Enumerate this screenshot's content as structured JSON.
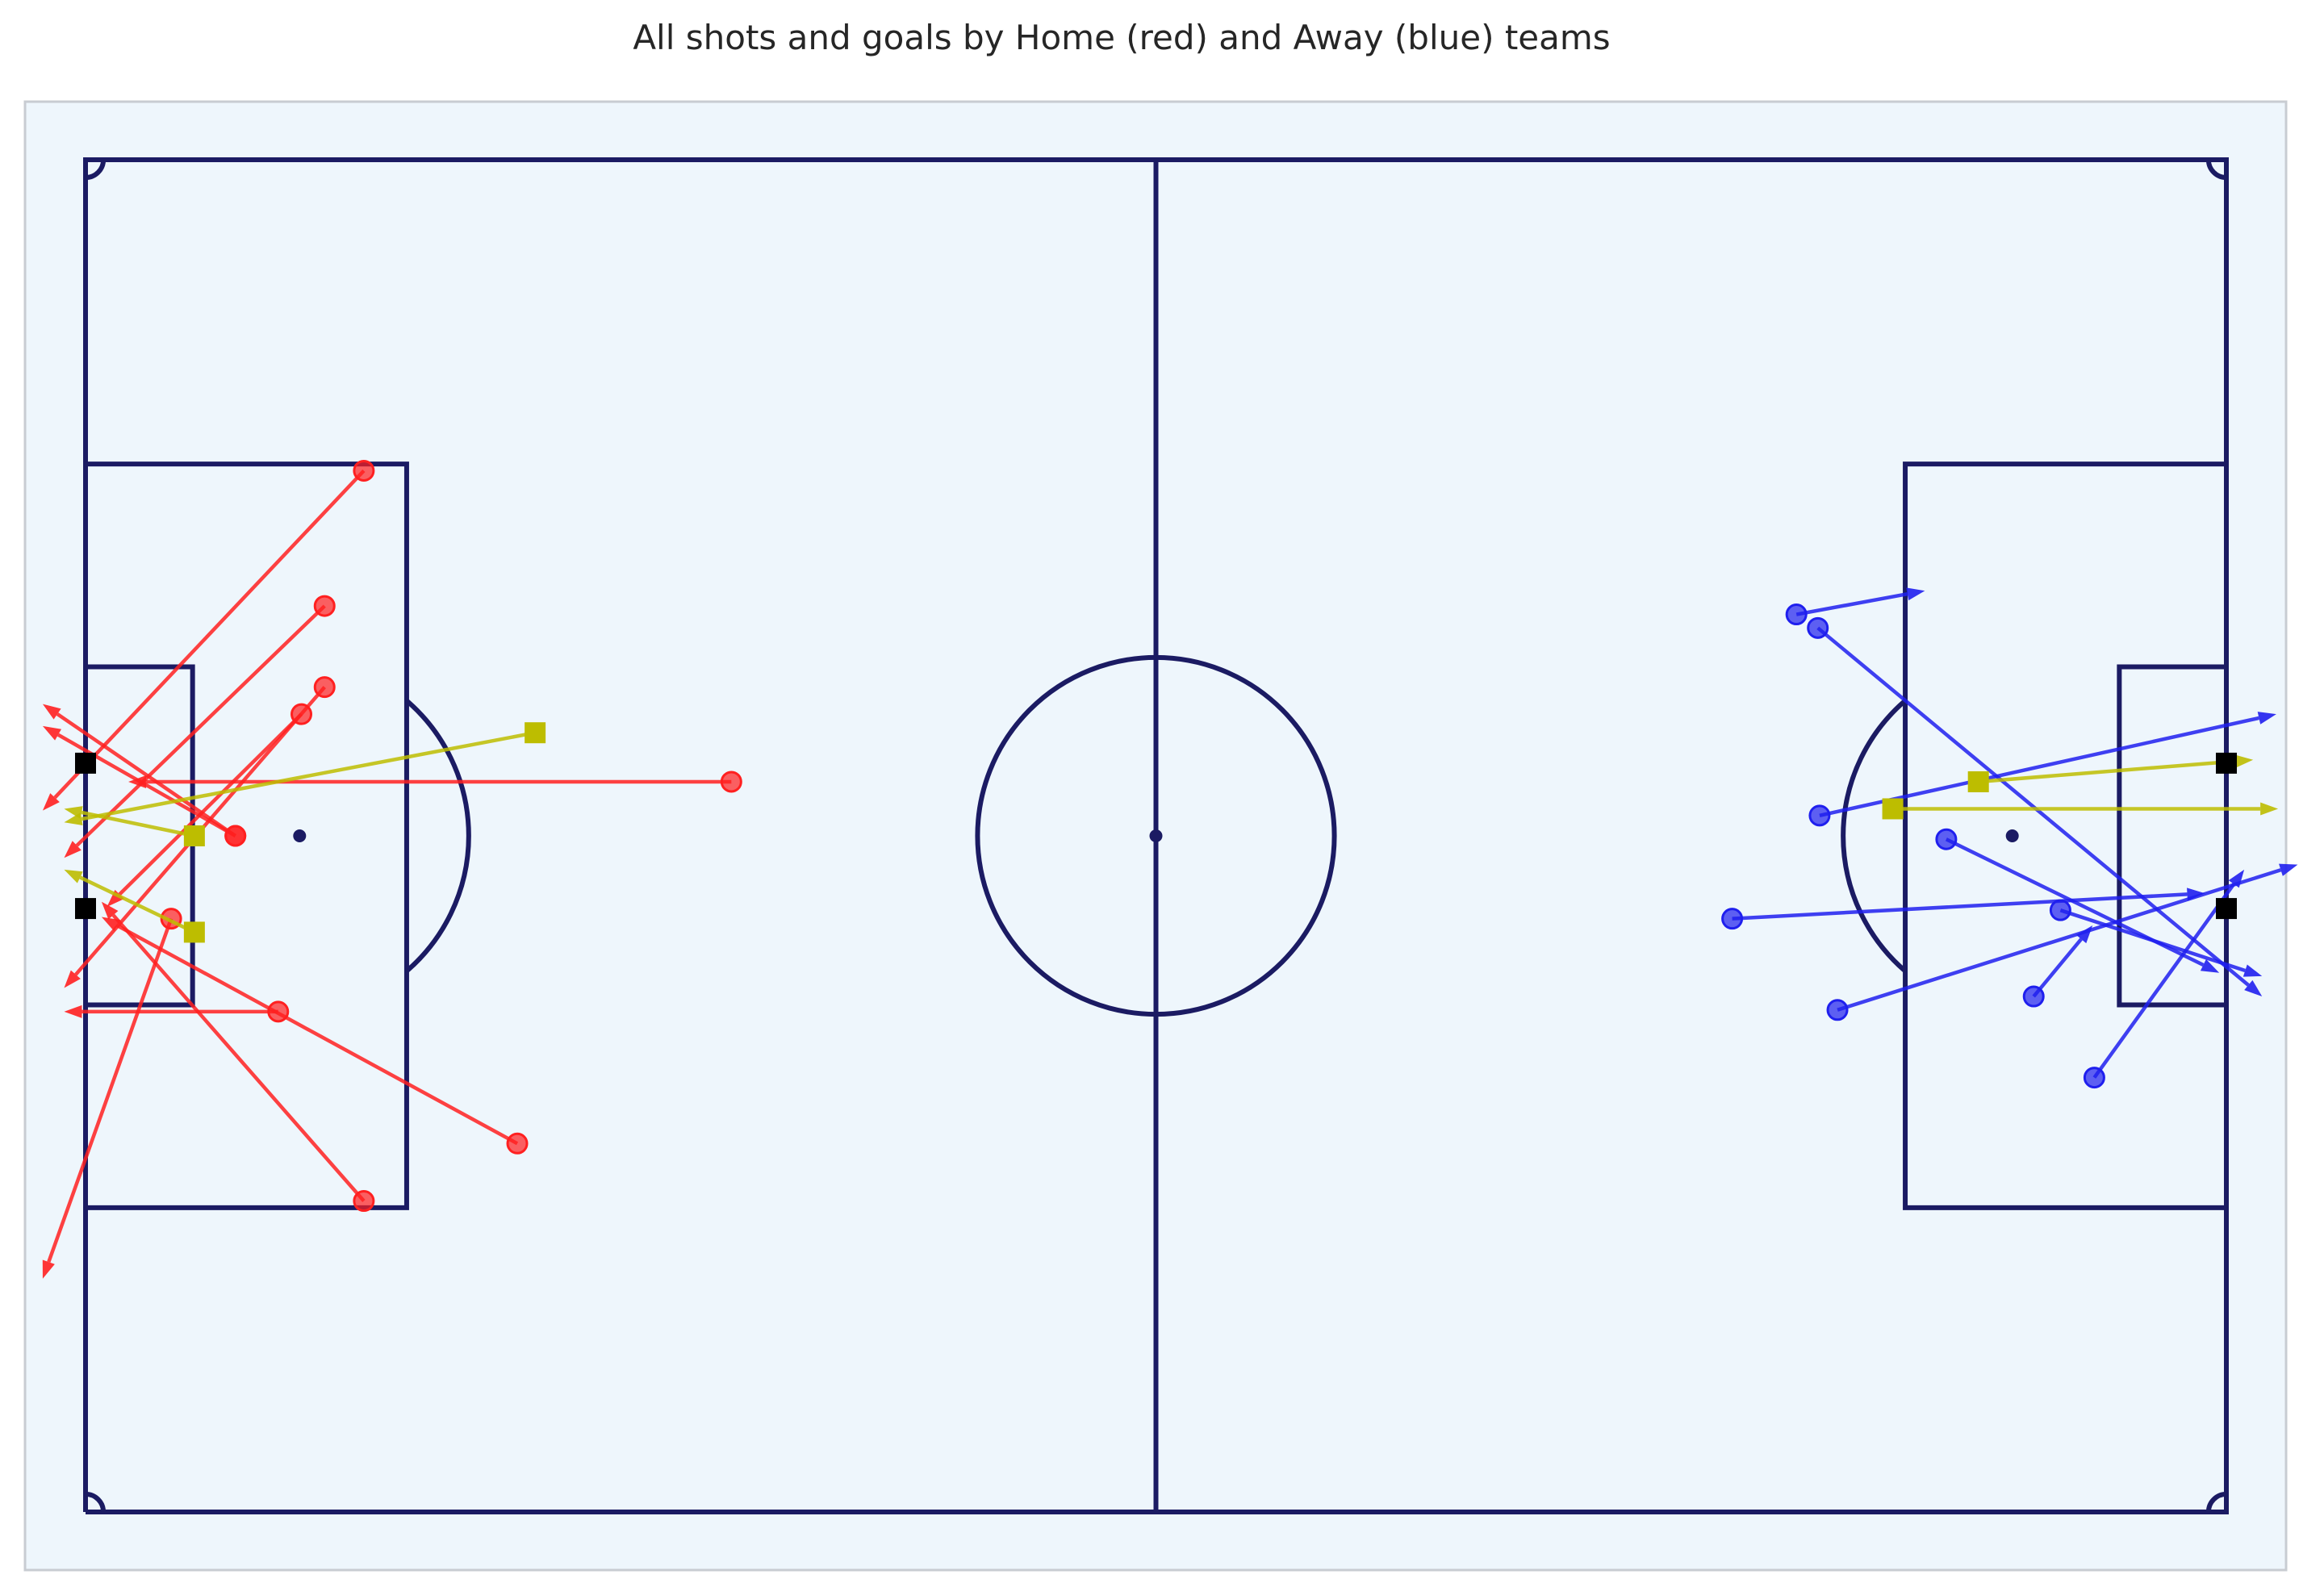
{
  "chart_data": {
    "type": "scatter",
    "title": "All shots and goals by Home (red) and Away (blue) teams",
    "pitch": {
      "length": 120,
      "width": 80,
      "xlim": [
        -3.3,
        123.3
      ],
      "ylim": [
        -3.3,
        83.3
      ]
    },
    "colors": {
      "pitch_background": "#eef6fc",
      "frame_border": "#c8ccd2",
      "pitch_lines": "#1b1b63",
      "home": "#ff2020",
      "away": "#1f1fee",
      "goal": "#bdbd00",
      "goal_posts": "#000000"
    },
    "goal_posts": [
      {
        "x": 0,
        "y": 35.7
      },
      {
        "x": 0,
        "y": 44.3
      },
      {
        "x": 120,
        "y": 35.7
      },
      {
        "x": 120,
        "y": 44.3
      }
    ],
    "series": [
      {
        "name": "Home",
        "shots": [
          {
            "x": 15.6,
            "y": 61.6,
            "end_x": -2.4,
            "end_y": 41.5
          },
          {
            "x": 13.4,
            "y": 53.6,
            "end_x": -1.2,
            "end_y": 38.7
          },
          {
            "x": 13.4,
            "y": 48.8,
            "end_x": -1.2,
            "end_y": 31.0
          },
          {
            "x": 12.1,
            "y": 47.2,
            "end_x": 1.2,
            "end_y": 35.8
          },
          {
            "x": 8.4,
            "y": 40.0,
            "end_x": -2.4,
            "end_y": 47.8
          },
          {
            "x": 8.4,
            "y": 40.0,
            "end_x": -2.4,
            "end_y": 46.5
          },
          {
            "x": 36.2,
            "y": 43.2,
            "end_x": 2.4,
            "end_y": 43.2
          },
          {
            "x": 4.8,
            "y": 35.1,
            "end_x": -2.4,
            "end_y": 13.8
          },
          {
            "x": 10.8,
            "y": 29.6,
            "end_x": -1.2,
            "end_y": 29.6
          },
          {
            "x": 24.2,
            "y": 21.8,
            "end_x": 0.9,
            "end_y": 35.2
          },
          {
            "x": 15.6,
            "y": 18.4,
            "end_x": 0.9,
            "end_y": 36.1
          }
        ],
        "goals": [
          {
            "x": 25.2,
            "y": 46.1,
            "end_x": -1.2,
            "end_y": 40.8
          },
          {
            "x": 6.1,
            "y": 40.0,
            "end_x": -1.2,
            "end_y": 41.6
          },
          {
            "x": 6.1,
            "y": 34.3,
            "end_x": -1.2,
            "end_y": 38.0
          }
        ]
      },
      {
        "name": "Away",
        "shots": [
          {
            "x": 95.9,
            "y": 53.1,
            "end_x": 103.1,
            "end_y": 54.5
          },
          {
            "x": 97.1,
            "y": 52.3,
            "end_x": 122.0,
            "end_y": 30.5
          },
          {
            "x": 97.2,
            "y": 41.2,
            "end_x": 122.8,
            "end_y": 47.2
          },
          {
            "x": 104.3,
            "y": 39.8,
            "end_x": 119.6,
            "end_y": 31.9
          },
          {
            "x": 92.3,
            "y": 35.1,
            "end_x": 118.8,
            "end_y": 36.6
          },
          {
            "x": 110.7,
            "y": 35.6,
            "end_x": 122.0,
            "end_y": 31.7
          },
          {
            "x": 98.2,
            "y": 29.7,
            "end_x": 124.0,
            "end_y": 38.3
          },
          {
            "x": 109.2,
            "y": 30.5,
            "end_x": 112.5,
            "end_y": 34.7
          },
          {
            "x": 112.6,
            "y": 25.7,
            "end_x": 121.0,
            "end_y": 38.0
          }
        ],
        "goals": [
          {
            "x": 101.3,
            "y": 41.6,
            "end_x": 122.9,
            "end_y": 41.6
          },
          {
            "x": 106.1,
            "y": 43.2,
            "end_x": 121.5,
            "end_y": 44.5
          }
        ]
      }
    ]
  }
}
